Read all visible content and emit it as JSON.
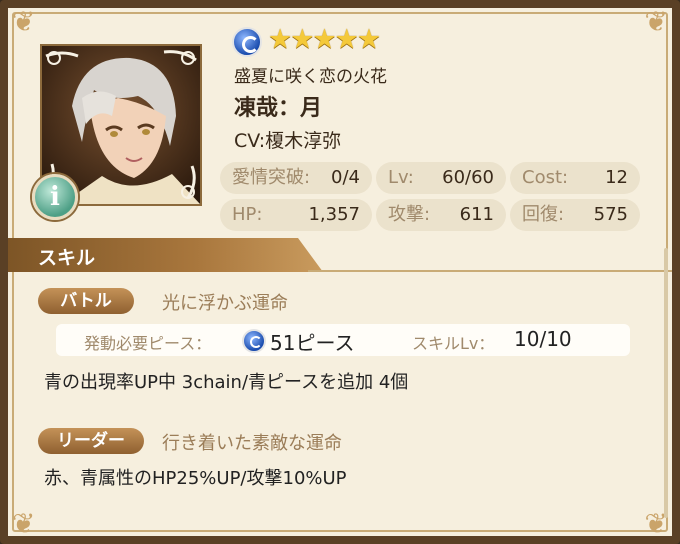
{
  "card": {
    "rarity_stars": "★★★★★",
    "title": "盛夏に咲く恋の火花",
    "character_name": "凍哉：月",
    "cv": "CV:榎木淳弥"
  },
  "info_button": {
    "label": "i"
  },
  "stats": {
    "affection": {
      "label": "愛情突破:",
      "value": "0/4"
    },
    "level": {
      "label": "Lv:",
      "value": "60/60"
    },
    "cost": {
      "label": "Cost:",
      "value": "12"
    },
    "hp": {
      "label": "HP:",
      "value": "1,357"
    },
    "attack": {
      "label": "攻撃:",
      "value": "611"
    },
    "recovery": {
      "label": "回復:",
      "value": "575"
    }
  },
  "skill_section": {
    "header": "スキル",
    "battle": {
      "tag": "バトル",
      "name": "光に浮かぶ運命",
      "activation_label": "発動必要ピース：",
      "activation_value": "51ピース",
      "skill_lv_label": "スキルLv：",
      "skill_lv_value": "10/10",
      "description": "青の出現率UP中 3chain/青ピースを追加 4個"
    },
    "leader": {
      "tag": "リーダー",
      "name": "行き着いた素敵な運命",
      "description": "赤、青属性のHP25%UP/攻撃10%UP"
    }
  },
  "colors": {
    "panel_bg": "#f6efde",
    "frame": "#5a4025",
    "tag_gold": "#a87840",
    "attribute_blue": "#1a4cae"
  }
}
